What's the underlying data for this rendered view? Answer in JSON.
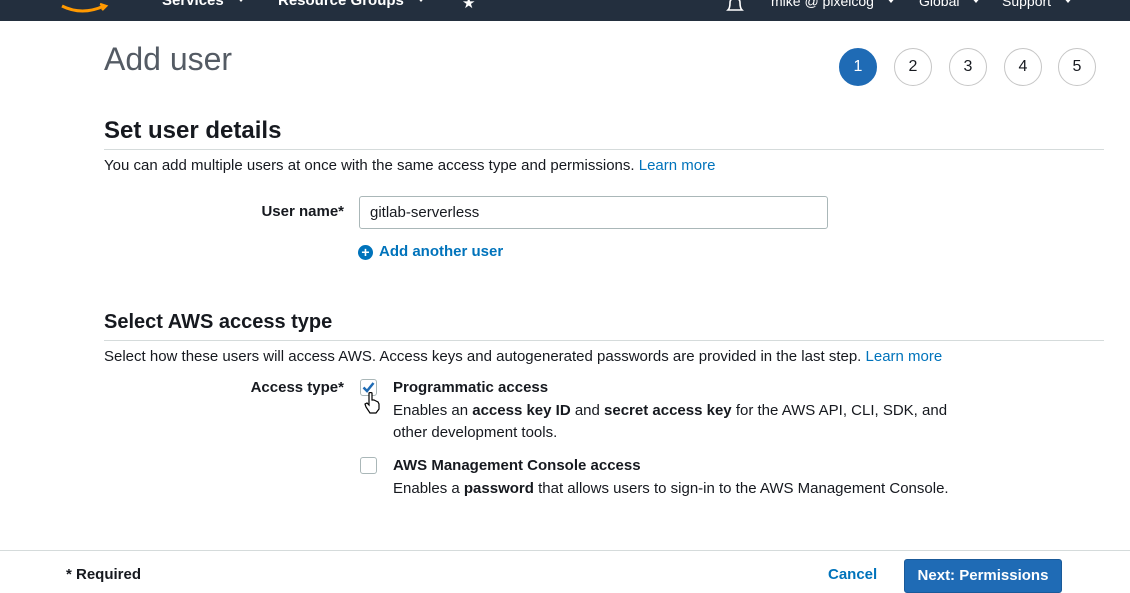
{
  "topbar": {
    "services_label": "Services",
    "resource_groups_label": "Resource Groups",
    "account_label": "mike @ pixelcog",
    "region_label": "Global",
    "support_label": "Support"
  },
  "page": {
    "title": "Add user",
    "steps": [
      "1",
      "2",
      "3",
      "4",
      "5"
    ],
    "active_step": "1"
  },
  "details": {
    "title": "Set user details",
    "description": "You can add multiple users at once with the same access type and permissions.",
    "learn_more": "Learn more",
    "username_label": "User name*",
    "username_value": "gitlab-serverless",
    "add_another": "Add another user"
  },
  "access": {
    "title": "Select AWS access type",
    "description": "Select how these users will access AWS. Access keys and autogenerated passwords are provided in the last step.",
    "learn_more": "Learn more",
    "type_label": "Access type*",
    "programmatic": {
      "title": "Programmatic access",
      "checked": true,
      "desc_1": "Enables an",
      "desc_b1": "access key ID",
      "desc_2": "and",
      "desc_b2": "secret access key",
      "desc_3": "for the AWS API, CLI, SDK, and other development tools."
    },
    "console": {
      "title": "AWS Management Console access",
      "checked": false,
      "desc_1": "Enables a",
      "desc_b1": "password",
      "desc_2": "that allows users to sign-in to the AWS Management Console."
    }
  },
  "footer": {
    "required": "* Required",
    "cancel": "Cancel",
    "next": "Next: Permissions"
  }
}
